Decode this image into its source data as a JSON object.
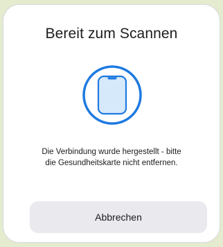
{
  "dialog": {
    "title": "Bereit zum Scannen",
    "message_line1": "Die Verbindung wurde hergestellt - bitte",
    "message_line2": "die Gesundheitskarte nicht entfernen.",
    "cancel_label": "Abbrechen"
  },
  "icons": {
    "scan_graphic": "phone-in-circle-icon"
  },
  "colors": {
    "accent": "#1f7ae0",
    "phone_fill": "#d6e9fb",
    "button_bg": "#e9e9ee",
    "background": "#e4ebcf"
  }
}
